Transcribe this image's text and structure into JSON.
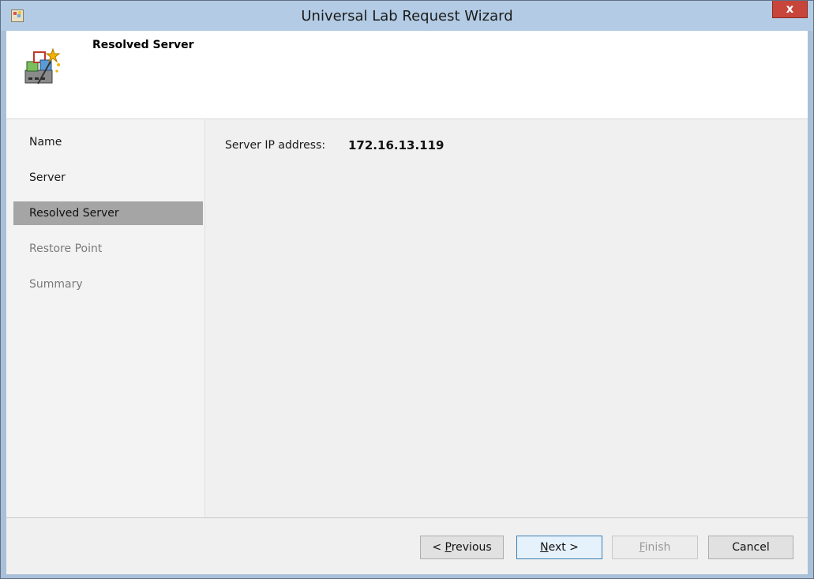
{
  "window": {
    "title": "Universal Lab Request Wizard",
    "close_label": "x",
    "app_icon": "wizard-app-icon"
  },
  "header": {
    "title": "Resolved Server",
    "icon": "server-wizard-icon"
  },
  "nav": {
    "items": [
      {
        "label": "Name",
        "state": "normal"
      },
      {
        "label": "Server",
        "state": "normal"
      },
      {
        "label": "Resolved Server",
        "state": "selected"
      },
      {
        "label": "Restore Point",
        "state": "disabled"
      },
      {
        "label": "Summary",
        "state": "disabled"
      }
    ]
  },
  "content": {
    "server_ip_label": "Server IP address:",
    "server_ip_value": "172.16.13.119"
  },
  "footer": {
    "previous_prefix": "< ",
    "previous_mnemonic": "P",
    "previous_rest": "revious",
    "next_mnemonic": "N",
    "next_rest": "ext >",
    "finish_mnemonic": "F",
    "finish_rest": "inish",
    "cancel_label": "Cancel"
  },
  "colors": {
    "titlebar": "#b3cbe4",
    "close_button": "#c7453a",
    "selected_nav": "#a5a5a5"
  }
}
